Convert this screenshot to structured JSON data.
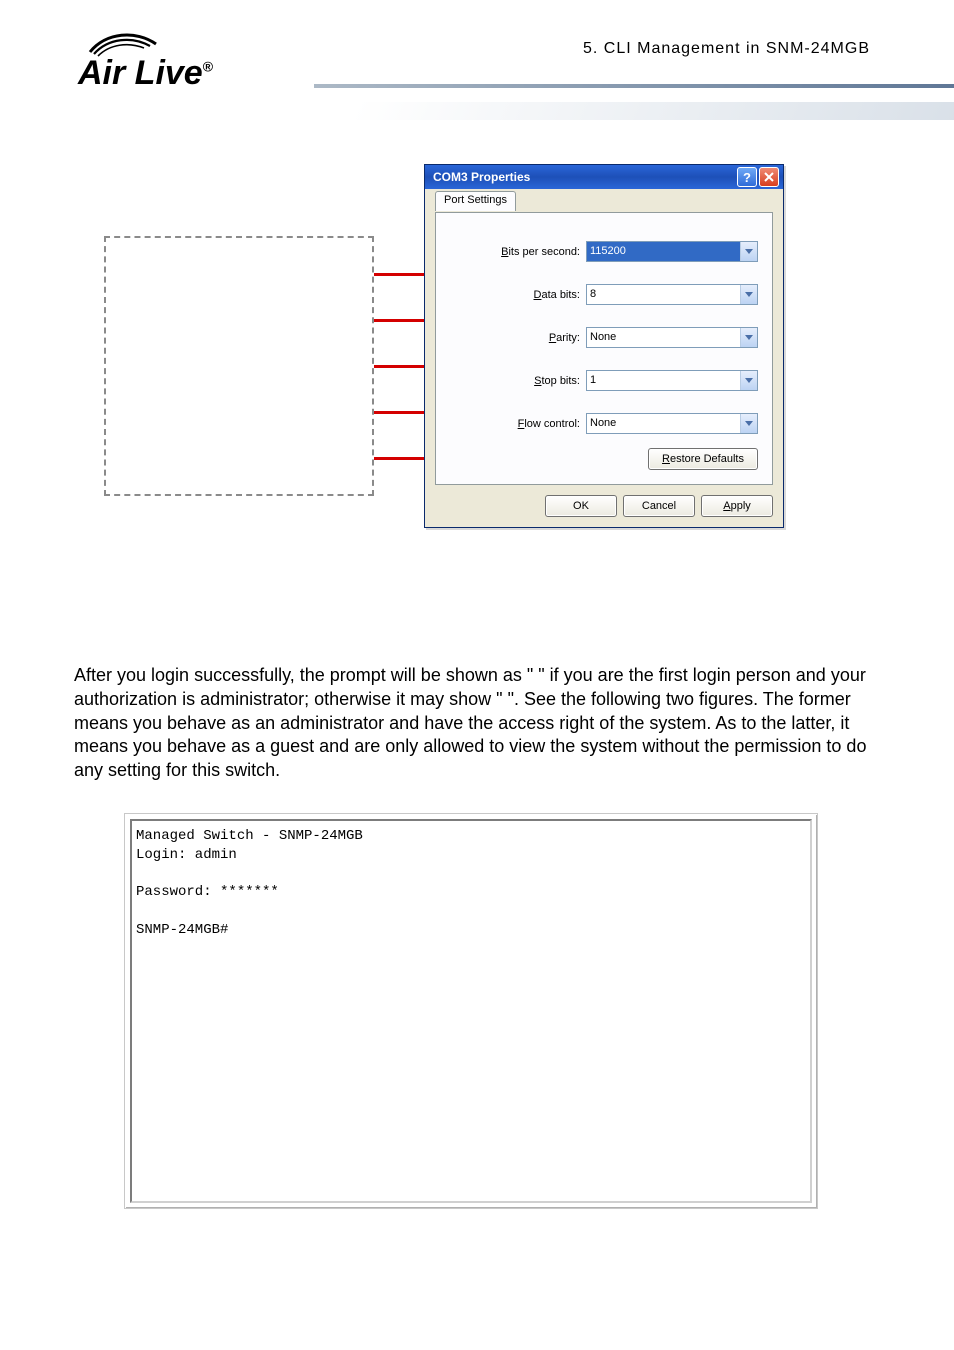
{
  "header": {
    "section_label": "5.  CLI Management in SNM-24MGB",
    "logo_text": "Air Live"
  },
  "dialog": {
    "title": "COM3 Properties",
    "tab_label": "Port Settings",
    "fields": {
      "bits_per_second": {
        "label_pre": "B",
        "label_rest": "its per second:",
        "value": "115200"
      },
      "data_bits": {
        "label_pre": "D",
        "label_rest": "ata bits:",
        "value": "8"
      },
      "parity": {
        "label_pre": "P",
        "label_rest": "arity:",
        "value": "None"
      },
      "stop_bits": {
        "label_pre": "S",
        "label_rest": "top bits:",
        "value": "1"
      },
      "flow_control": {
        "label_pre": "F",
        "label_rest": "low control:",
        "value": "None"
      }
    },
    "restore_pre": "R",
    "restore_rest": "estore Defaults",
    "ok": "OK",
    "cancel": "Cancel",
    "apply_pre": "A",
    "apply_rest": "pply"
  },
  "body_text": "After you login successfully, the prompt will be shown as \"  \" if you are the first login person and your authorization is administrator; otherwise it may show \"  \". See the following two figures. The former means you behave as an administrator and have the access right of the system. As to the latter, it means you behave as a guest and are only allowed to view the system without the permission to do any setting for this switch.",
  "terminal": "Managed Switch - SNMP-24MGB\nLogin: admin\n\nPassword: *******\n\nSNMP-24MGB#"
}
